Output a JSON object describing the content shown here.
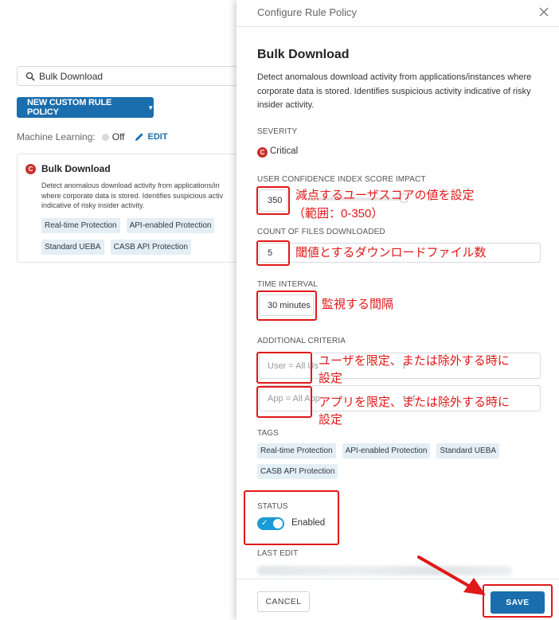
{
  "background": {
    "search": {
      "value": "Bulk Download"
    },
    "new_rule_button": "NEW CUSTOM RULE POLICY",
    "machine_learning": {
      "label": "Machine Learning:",
      "state": "Off",
      "edit": "EDIT"
    },
    "card": {
      "severity_letter": "C",
      "title": "Bulk Download",
      "description_lines": [
        "Detect anomalous download activity from applications/in",
        "where corporate data is stored. Identifies suspicious activ",
        "indicative of risky insider activity."
      ],
      "tags": [
        "Real-time Protection",
        "API-enabled Protection",
        "Standard UEBA",
        "CASB API Protection"
      ]
    }
  },
  "drawer": {
    "header_title": "Configure Rule Policy",
    "title": "Bulk Download",
    "description": "Detect anomalous download activity from applications/instances where corporate data is stored. Identifies suspicious activity indicative of risky insider activity.",
    "severity": {
      "label": "SEVERITY",
      "letter": "C",
      "value": "Critical"
    },
    "ucis": {
      "label": "USER CONFIDENCE INDEX SCORE IMPACT",
      "value": "350"
    },
    "count": {
      "label": "COUNT OF FILES DOWNLOADED",
      "value": "5"
    },
    "interval": {
      "label": "TIME INTERVAL",
      "value": "30 minutes"
    },
    "criteria": {
      "label": "ADDITIONAL CRITERIA",
      "user_value": "User = All Us",
      "user_hint": "t",
      "app_value": "App = All App",
      "app_hint": "t of"
    },
    "tags": {
      "label": "TAGS",
      "items": [
        "Real-time Protection",
        "API-enabled Protection",
        "Standard UEBA",
        "CASB API Protection"
      ]
    },
    "status": {
      "label": "STATUS",
      "value": "Enabled",
      "enabled": true
    },
    "last_edit": {
      "label": "LAST EDIT"
    },
    "buttons": {
      "cancel": "CANCEL",
      "save": "SAVE"
    }
  },
  "annotations": {
    "score_line1": "減点するユーザスコアの値を設定",
    "score_line2": "（範囲：0-350）",
    "count": "閾値とするダウンロードファイル数",
    "interval": "監視する間隔",
    "user_line1": "ユーザを限定、または除外する時に",
    "user_line2": "設定",
    "app_line1": "アプリを限定、または除外する時に",
    "app_line2": "設定"
  },
  "colors": {
    "accent": "#1b6ead",
    "critical": "#c9302c",
    "toggle": "#1a9ad6",
    "annotation": "#e01818"
  }
}
